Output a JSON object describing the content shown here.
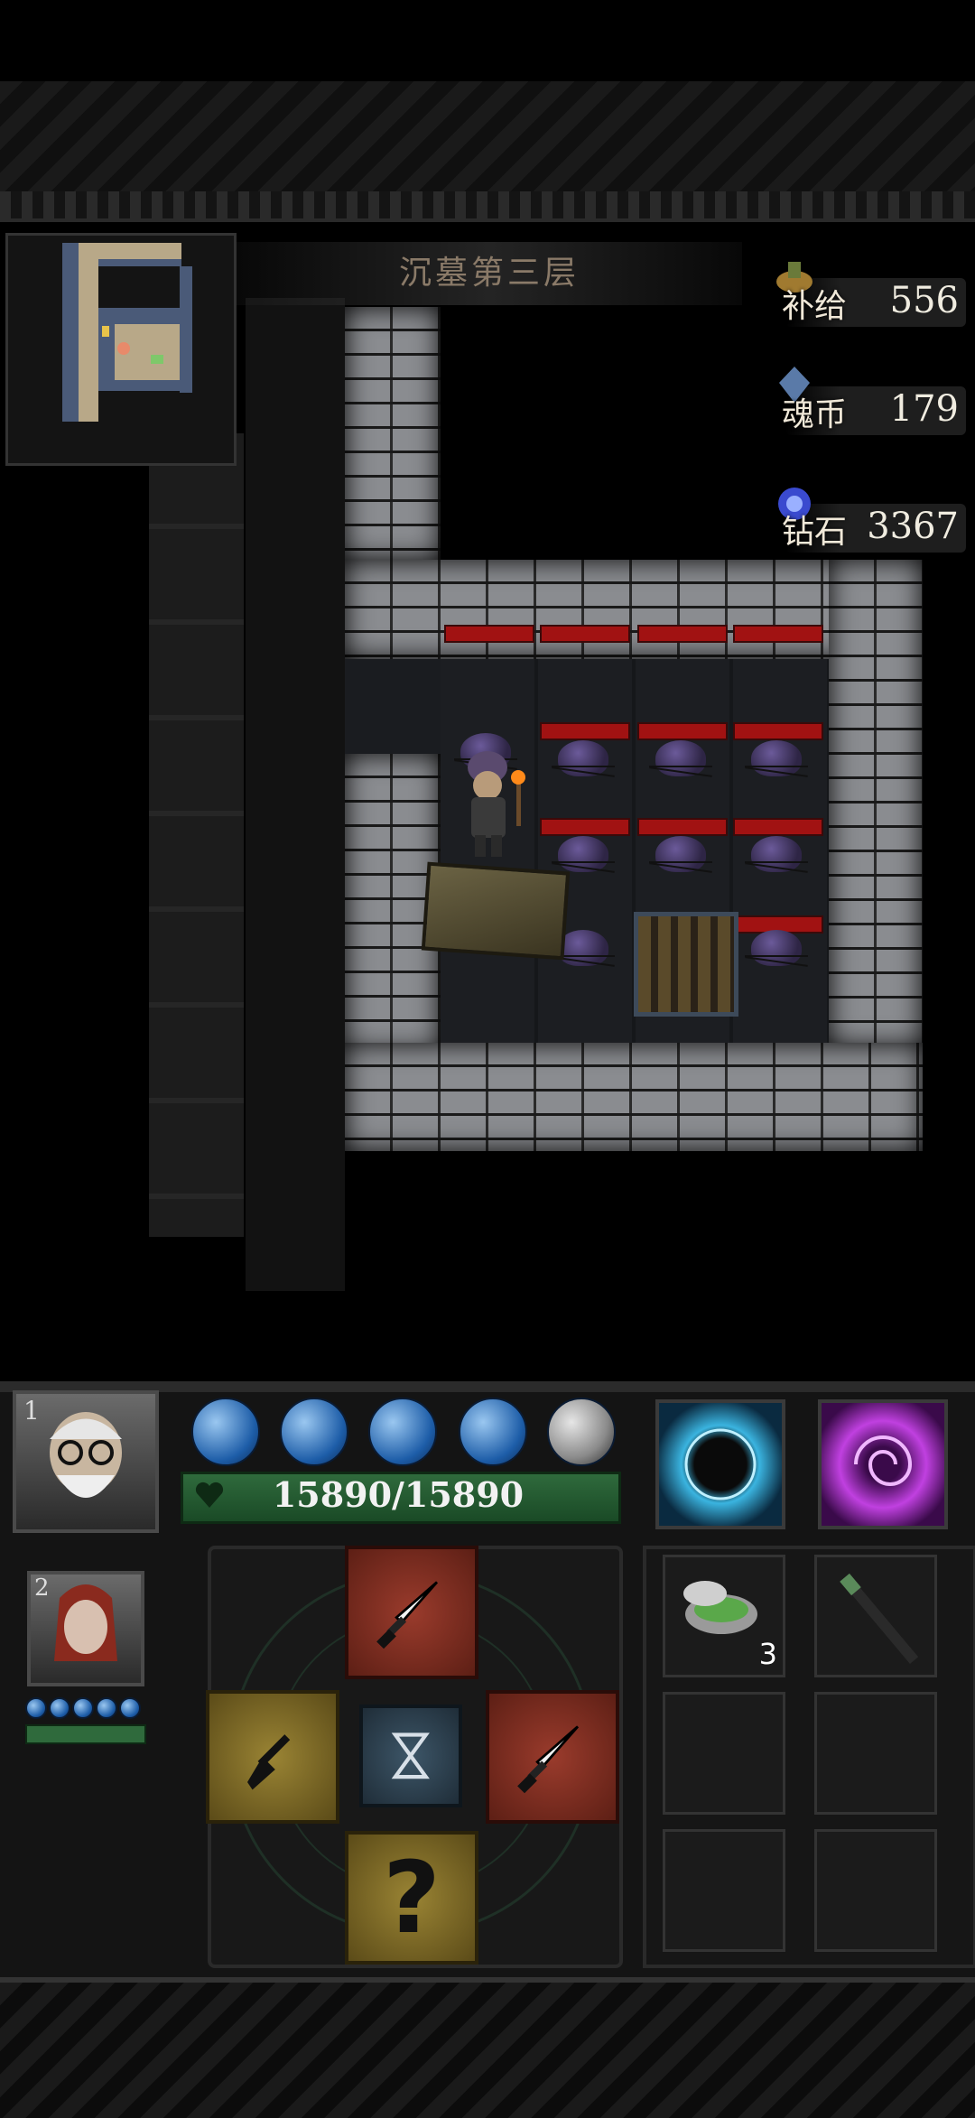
{
  "floor": {
    "name": "沉墓第三层"
  },
  "currencies": [
    {
      "label": "补给",
      "value": "556",
      "icon": "supply-icon"
    },
    {
      "label": "魂币",
      "value": "179",
      "icon": "soul-coin-icon"
    },
    {
      "label": "钻石",
      "value": "3367",
      "icon": "diamond-icon"
    }
  ],
  "party": {
    "hero1": {
      "slot": "1",
      "hp": "15890/15890",
      "mana_orbs": 5
    },
    "hero2": {
      "slot": "2"
    }
  },
  "skills": [
    {
      "icon": "lightning-vortex-icon"
    },
    {
      "icon": "purple-vortex-icon"
    }
  ],
  "actions": {
    "attack_up": {
      "icon": "dagger-icon"
    },
    "dig": {
      "icon": "shovel-icon"
    },
    "wait": {
      "icon": "hourglass-icon"
    },
    "attack_right": {
      "icon": "dagger-icon"
    },
    "unknown": {
      "label": "?"
    }
  },
  "inventory": [
    {
      "icon": "potion-bowl-icon",
      "count": "3"
    },
    {
      "icon": "wand-icon",
      "count": ""
    },
    {
      "icon": "empty-slot",
      "count": ""
    },
    {
      "icon": "empty-slot",
      "count": ""
    },
    {
      "icon": "empty-slot",
      "count": ""
    },
    {
      "icon": "empty-slot",
      "count": ""
    }
  ]
}
